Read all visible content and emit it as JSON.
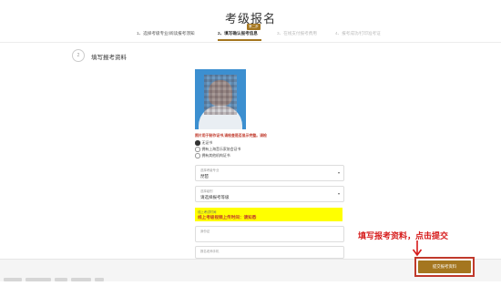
{
  "page": {
    "title": "考级报名"
  },
  "steps": [
    {
      "label": "1、选择考级专业/阅读报考须知",
      "state": "done"
    },
    {
      "label": "2、填写确认报考信息",
      "state": "active"
    },
    {
      "label": "3、在线支付报考费用",
      "state": "todo"
    },
    {
      "label": "4、报考成功/打印准考证",
      "state": "todo"
    }
  ],
  "current_step_badge": "第二步",
  "section": {
    "number": "2",
    "title": "填写报考资料"
  },
  "photo": {
    "note": "照片用于制作证书,请检查是否显示完整。请检"
  },
  "cert_options": [
    {
      "label": "无证书",
      "selected": true
    },
    {
      "label": "拥有上海音乐家协会证书",
      "selected": false
    },
    {
      "label": "拥有其他机构证书",
      "selected": false
    }
  ],
  "fields": {
    "major": {
      "label": "选择考级专业",
      "value": "琵琶"
    },
    "level": {
      "label": "选择级别",
      "value": "请选择报考等级"
    },
    "exam_time": {
      "label": "线上考试时间",
      "value": "线上考级视频上传时间：请知悉"
    },
    "id_card": {
      "label": "身份证",
      "value": ""
    },
    "phone": {
      "label": "报名老师手机",
      "value": ""
    }
  },
  "annotation": {
    "text": "填写报考资料，点击提交"
  },
  "submit": {
    "label": "提交报考资料"
  },
  "colors": {
    "accent": "#a4761f",
    "annotation": "#d61b1b",
    "highlight": "#ffff00",
    "photo_bg": "#3c8fd0"
  }
}
